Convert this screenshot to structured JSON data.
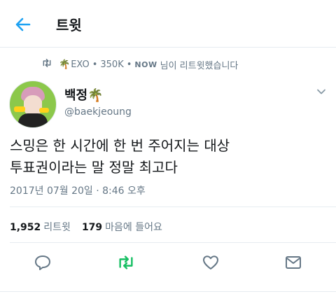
{
  "header": {
    "title": "트윗",
    "back_icon": "arrow-left-icon",
    "accent": "#1da1f2"
  },
  "retweet_context": {
    "palm": "🌴",
    "name": "EXO",
    "followers": "350K",
    "now": "NOW",
    "text": "님이 리트윗했습니다"
  },
  "tweet": {
    "display_name": "백정",
    "name_emoji": "🌴",
    "handle": "@baekjeoung",
    "lines": [
      "스밍은 한 시간에 한 번 주어지는 대상",
      "투표권이라는 말 정말 최고다"
    ],
    "timestamp": "2017년 07월 20일 · 8:46 오후"
  },
  "stats": {
    "retweets_count": "1,952",
    "retweets_label": "리트윗",
    "likes_count": "179",
    "likes_label": "마음에 들어요"
  },
  "colors": {
    "text": "#14171a",
    "secondary": "#657786",
    "retweet_green": "#17bf63",
    "divider": "#e6ecf0"
  }
}
